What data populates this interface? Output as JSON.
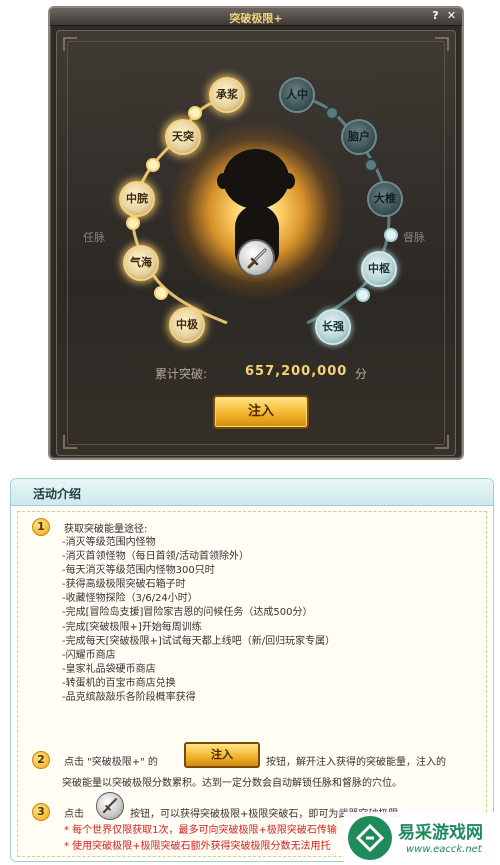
{
  "window": {
    "title": "突破极限+",
    "help": "?",
    "close": "✕"
  },
  "meridians": {
    "ren_label": "任脉",
    "du_label": "督脉",
    "ren_nodes": [
      "承浆",
      "天突",
      "中脘",
      "气海",
      "中极"
    ],
    "du_nodes": [
      "人中",
      "脑户",
      "大椎",
      "中枢",
      "长强"
    ]
  },
  "total": {
    "label": "累计突破:",
    "value": "657,200,000",
    "unit": "分"
  },
  "inject_button": "注入",
  "info": {
    "title": "活动介绍",
    "step1": {
      "num": "1",
      "title": "获取突破能量途径:",
      "sources": [
        "-消灭等级范围内怪物",
        "-消灭首领怪物（每日首领/活动首领除外）",
        "-每天消灭等级范围内怪物300只时",
        "-获得高级极限突破石箱子时",
        "-收藏怪物探险（3/6/24小时）",
        "-完成[冒险岛支援]冒险家吉恩的问候任务（达成500分）",
        "-完成[突破极限+]开始每周训练",
        "-完成每天[突破极限+]试试每天都上线吧（新/回归玩家专属）",
        "-闪耀币商店",
        "-皇家礼品袋硬币商店",
        "-转蛋机的百宝市商店兑换",
        "-品克缤敲敲乐各阶段概率获得"
      ]
    },
    "step2": {
      "num": "2",
      "before": "点击 \"突破极限+\" 的",
      "button": "注入",
      "after": "按钮，解开注入获得的突破能量，注入的",
      "line2": "突破能量以突破极限分数累积。达到一定分数会自动解锁任脉和督脉的穴位。"
    },
    "step3": {
      "num": "3",
      "before": "点击",
      "after": "按钮，可以获得突破极限+极限突破石，即可为武器突破极限。",
      "note1": "* 每个世界仅限获取1次，最多可向突破极限+极限突破石传输",
      "note2": "* 使用突破极限+极限突破石额外获得突破极限分数无法用托"
    }
  },
  "watermark": {
    "name": "易采游戏网",
    "url": "www.eacck.net"
  },
  "colors": {
    "gold_node": "#f6d27a",
    "teal_node": "#6a8a8c",
    "accent_number": "#f6d27a",
    "note_red": "#e0201e",
    "info_border": "#9fd3d3"
  }
}
